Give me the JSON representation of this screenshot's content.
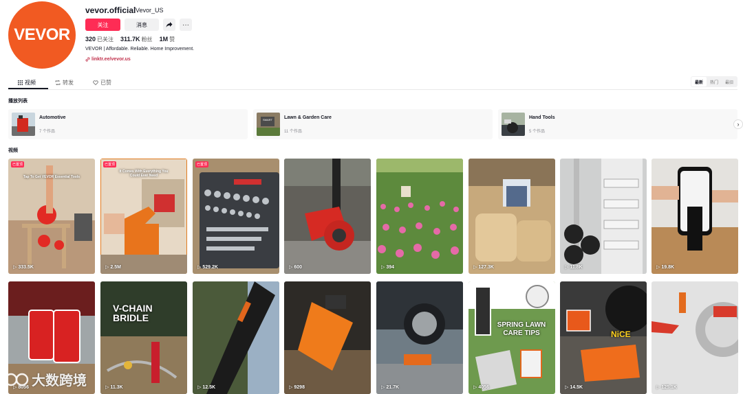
{
  "profile": {
    "avatar_text": "VEVOR",
    "username": "vevor.official",
    "nickname": "Vevor_US",
    "follow_label": "关注",
    "message_label": "消息",
    "following_count": "320",
    "following_label": "已关注",
    "followers_count": "311.7K",
    "followers_label": "粉丝",
    "likes_count": "1M",
    "likes_label": "赞",
    "bio": "VEVOR | Affordable. Reliable. Home Improvement.",
    "link": "linktr.ee/vevor.us"
  },
  "tabs": [
    {
      "label": "视频",
      "icon": "grid-icon"
    },
    {
      "label": "转发",
      "icon": "repost-icon"
    },
    {
      "label": "已赞",
      "icon": "heart-outline-icon"
    }
  ],
  "sort": [
    "最新",
    "热门",
    "最旧"
  ],
  "playlists_label": "播放列表",
  "playlists": [
    {
      "title": "Automotive",
      "count": "7 个作品"
    },
    {
      "title": "Lawn & Garden Care",
      "count": "11 个作品"
    },
    {
      "title": "Hand Tools",
      "count": "5 个作品"
    }
  ],
  "videos_label": "视频",
  "pinned_label": "已置顶",
  "videos": [
    {
      "views": "333.5K",
      "pinned": true,
      "caption": "Tap To Get VEVOR Essential Tools"
    },
    {
      "views": "2.5M",
      "pinned": true,
      "caption": "It Comes With Everything You Could Ever Need"
    },
    {
      "views": "529.2K",
      "pinned": true,
      "caption": ""
    },
    {
      "views": "600",
      "pinned": false,
      "caption": ""
    },
    {
      "views": "394",
      "pinned": false,
      "caption": ""
    },
    {
      "views": "127.3K",
      "pinned": false,
      "caption": ""
    },
    {
      "views": "11.8K",
      "pinned": false,
      "caption": ""
    },
    {
      "views": "19.8K",
      "pinned": false,
      "caption": ""
    },
    {
      "views": "8056",
      "pinned": false,
      "caption": ""
    },
    {
      "views": "11.3K",
      "pinned": false,
      "caption": "V-CHAIN BRIDLE"
    },
    {
      "views": "12.5K",
      "pinned": false,
      "caption": ""
    },
    {
      "views": "9298",
      "pinned": false,
      "caption": ""
    },
    {
      "views": "21.7K",
      "pinned": false,
      "caption": ""
    },
    {
      "views": "4056",
      "pinned": false,
      "caption": "SPRING LAWN CARE TIPS"
    },
    {
      "views": "14.5K",
      "pinned": false,
      "caption": "NiCE"
    },
    {
      "views": "125.1K",
      "pinned": false,
      "caption": ""
    }
  ],
  "watermark": "大数跨境",
  "colors": {
    "brand": "#f15a22",
    "accent": "#fe2c55",
    "link": "#c1314c"
  }
}
